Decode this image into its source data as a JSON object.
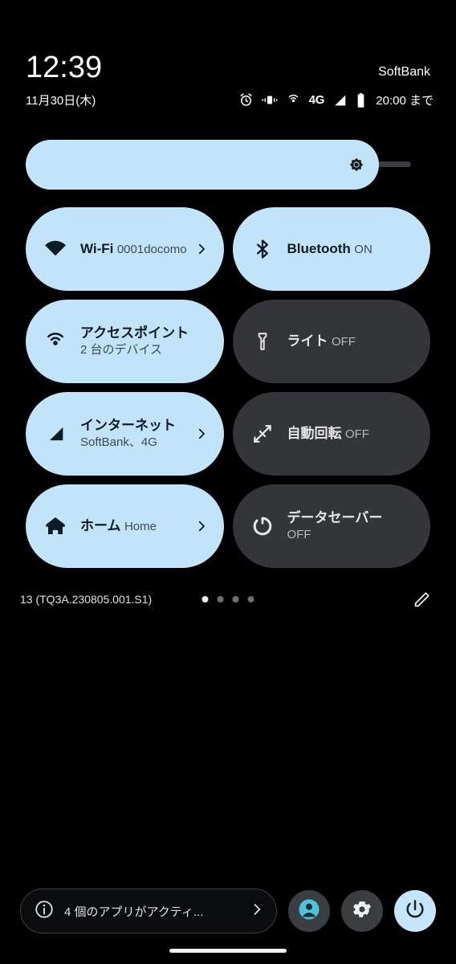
{
  "status": {
    "time": "12:39",
    "carrier": "SoftBank",
    "date": "11月30日(木)",
    "network_type": "4G",
    "battery_text": "20:00 まで",
    "icons": [
      "alarm-icon",
      "vibrate-icon",
      "hotspot-icon",
      "network-type-label",
      "signal-icon",
      "battery-icon"
    ]
  },
  "brightness": {
    "name": "brightness-slider",
    "icon": "brightness-sun-icon",
    "level_percent": 88
  },
  "tiles": [
    {
      "name": "wifi",
      "title": "Wi-Fi",
      "sub": "0001docomo",
      "active": true,
      "chevron": true,
      "icon": "wifi-icon"
    },
    {
      "name": "bluetooth",
      "title": "Bluetooth",
      "sub": "ON",
      "active": true,
      "chevron": false,
      "icon": "bluetooth-icon"
    },
    {
      "name": "hotspot",
      "title": "アクセスポイント",
      "sub": "2 台のデバイス",
      "active": true,
      "chevron": false,
      "icon": "hotspot-icon"
    },
    {
      "name": "flashlight",
      "title": "ライト",
      "sub": "OFF",
      "active": false,
      "chevron": false,
      "icon": "flashlight-icon"
    },
    {
      "name": "internet",
      "title": "インターネット",
      "sub": "SoftBank、4G",
      "active": true,
      "chevron": true,
      "icon": "signal-icon"
    },
    {
      "name": "auto-rotate",
      "title": "自動回転",
      "sub": "OFF",
      "active": false,
      "chevron": false,
      "icon": "auto-rotate-icon"
    },
    {
      "name": "home",
      "title": "ホーム",
      "sub": "Home",
      "active": true,
      "chevron": true,
      "icon": "home-icon"
    },
    {
      "name": "data-saver",
      "title": "データセーバー",
      "sub": "OFF",
      "active": false,
      "chevron": false,
      "icon": "data-saver-icon"
    }
  ],
  "panel_footer": {
    "build": "13 (TQ3A.230805.001.S1)",
    "page_count": 4,
    "active_page": 1,
    "edit_icon": "pencil-icon"
  },
  "bottom_bar": {
    "active_apps_label": "4 個のアプリがアクティ...",
    "info_icon": "info-icon",
    "chevron_icon": "chevron-right-icon",
    "user_icon": "user-avatar-icon",
    "settings_icon": "gear-icon",
    "power_icon": "power-icon"
  },
  "colors": {
    "background": "#000000",
    "tile_active": "#c2e4fb",
    "tile_inactive": "#333538",
    "tile_active_text": "#0d1b25",
    "accent": "#c6e5fb",
    "avatar_accent": "#4fc3dc"
  }
}
